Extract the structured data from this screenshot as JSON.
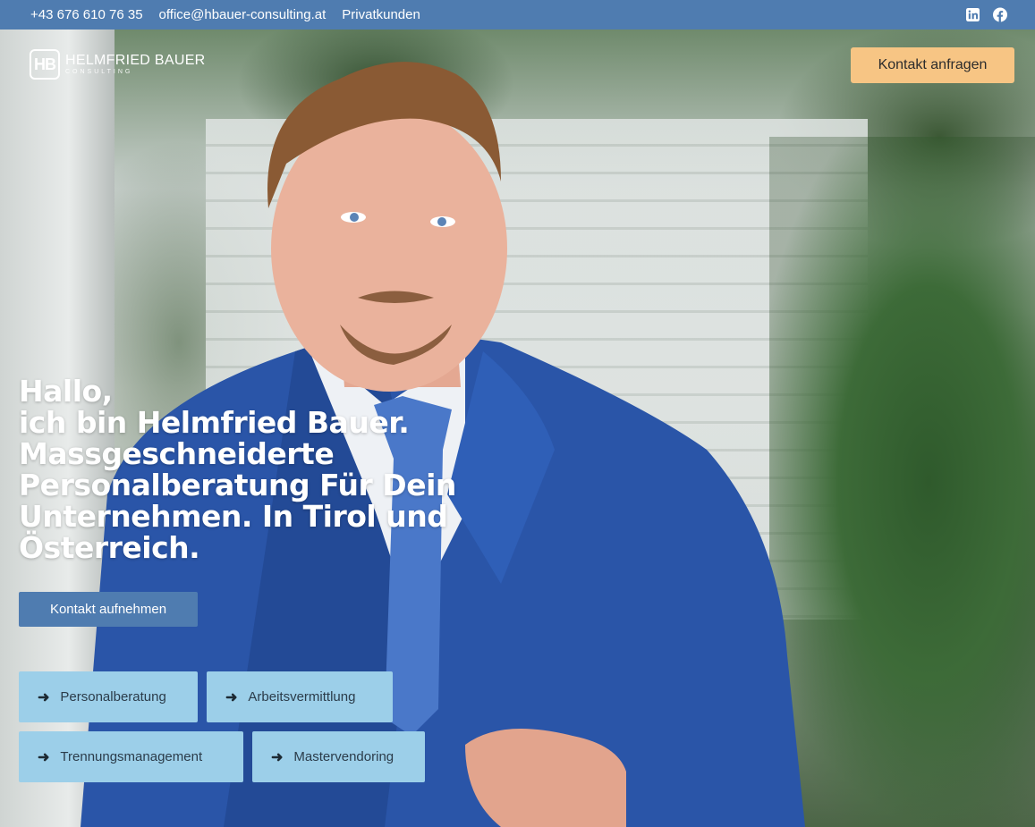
{
  "topbar": {
    "phone": "+43 676 610 76 35",
    "email": "office@hbauer-consulting.at",
    "link": "Privatkunden",
    "social": [
      "linkedin-icon",
      "facebook-icon"
    ]
  },
  "header": {
    "logo_mark": "HB",
    "logo_name": "HELMFRIED BAUER",
    "logo_sub": "CONSULTING",
    "cta_label": "Kontakt anfragen"
  },
  "hero": {
    "headline": [
      "Hallo,",
      "ich bin Helmfried Bauer.",
      "Massgeschneiderte",
      "Personalberatung Für Dein",
      "Unternehmen. In Tirol und",
      "Österreich."
    ],
    "cta_label": "Kontakt aufnehmen",
    "services": [
      "Personalberatung",
      "Arbeitsvermittlung",
      "Trennungsmanagement",
      "Mastervendoring"
    ]
  },
  "colors": {
    "topbar": "#4f7cb0",
    "cta_top": "#f7c584",
    "cta_main": "#4f7cb0",
    "service_bg": "#9ccfe9"
  }
}
